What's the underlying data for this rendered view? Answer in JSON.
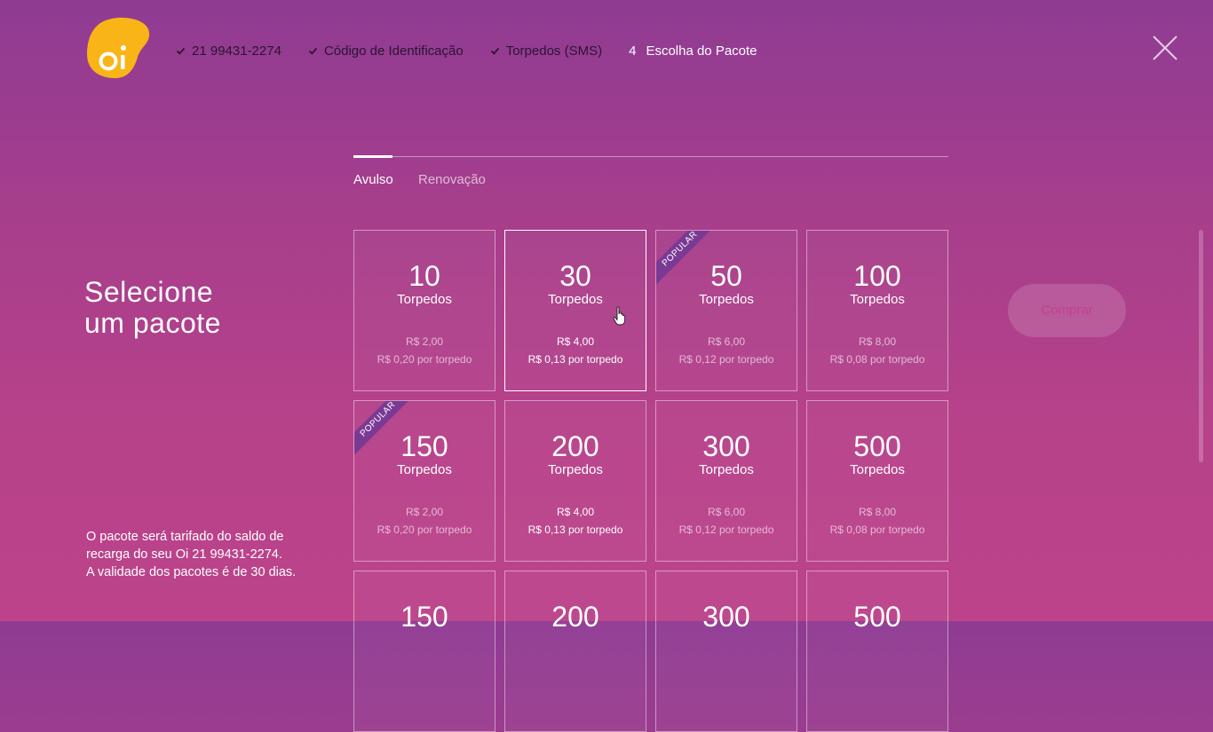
{
  "brand": {
    "logo_text": "oi",
    "logo_color": "#f9b418"
  },
  "steps": [
    {
      "label": "21 99431-2274",
      "icon": "check-icon",
      "done": true
    },
    {
      "label": "Código de Identificação",
      "icon": "check-icon",
      "done": true
    },
    {
      "label": "Torpedos (SMS)",
      "icon": "check-icon",
      "done": true
    },
    {
      "number": "4",
      "label": "Escolha do Pacote",
      "done": false
    }
  ],
  "tabs": [
    {
      "label": "Avulso",
      "active": true
    },
    {
      "label": "Renovação",
      "active": false
    }
  ],
  "heading": {
    "line1": "Selecione",
    "line2": "um pacote"
  },
  "note": {
    "line1": "O pacote será tarifado do saldo de",
    "line2": "recarga do seu Oi 21 99431-2274.",
    "line3": "A validade dos pacotes é de 30 dias."
  },
  "packages": [
    {
      "qty": "10",
      "unit": "Torpedos",
      "price": "R$ 2,00",
      "per": "R$ 0,20 por torpedo",
      "popular": false,
      "selected": false
    },
    {
      "qty": "30",
      "unit": "Torpedos",
      "price": "R$ 4,00",
      "per": "R$ 0,13 por torpedo",
      "popular": false,
      "selected": true
    },
    {
      "qty": "50",
      "unit": "Torpedos",
      "price": "R$ 6,00",
      "per": "R$ 0,12 por torpedo",
      "popular": true,
      "selected": false
    },
    {
      "qty": "100",
      "unit": "Torpedos",
      "price": "R$ 8,00",
      "per": "R$ 0,08 por torpedo",
      "popular": false,
      "selected": false
    },
    {
      "qty": "150",
      "unit": "Torpedos",
      "price": "R$ 2,00",
      "per": "R$ 0,20 por torpedo",
      "popular": true,
      "selected": false
    },
    {
      "qty": "200",
      "unit": "Torpedos",
      "price": "R$ 4,00",
      "per": "R$ 0,13 por torpedo",
      "popular": false,
      "selected": false,
      "bright": true
    },
    {
      "qty": "300",
      "unit": "Torpedos",
      "price": "R$ 6,00",
      "per": "R$ 0,12 por torpedo",
      "popular": false,
      "selected": false
    },
    {
      "qty": "500",
      "unit": "Torpedos",
      "price": "R$ 8,00",
      "per": "R$ 0,08 por torpedo",
      "popular": false,
      "selected": false
    },
    {
      "qty": "150",
      "unit": "",
      "price": "",
      "per": "",
      "popular": false,
      "selected": false
    },
    {
      "qty": "200",
      "unit": "",
      "price": "",
      "per": "",
      "popular": false,
      "selected": false
    },
    {
      "qty": "300",
      "unit": "",
      "price": "",
      "per": "",
      "popular": false,
      "selected": false
    },
    {
      "qty": "500",
      "unit": "",
      "price": "",
      "per": "",
      "popular": false,
      "selected": false
    }
  ],
  "popular_label": "POPULAR",
  "buy_button": {
    "label": "Comprar",
    "enabled": false
  },
  "close_icon": "close-icon"
}
